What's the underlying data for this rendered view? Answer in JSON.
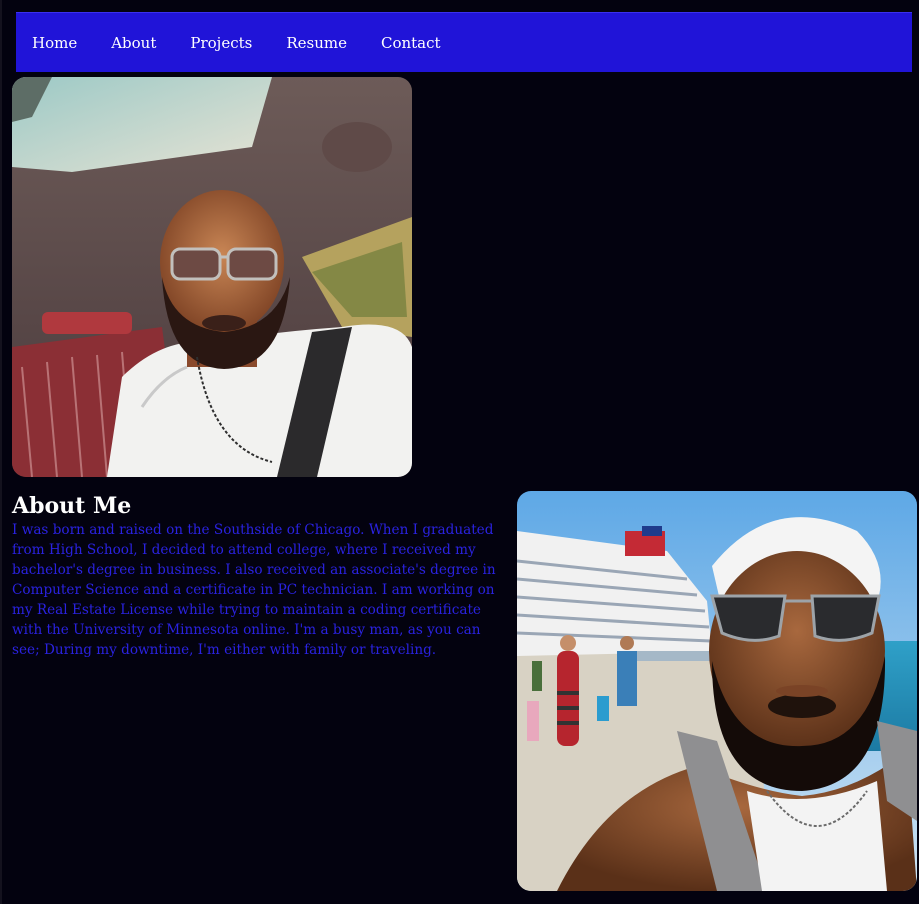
{
  "nav": {
    "items": [
      {
        "label": "Home"
      },
      {
        "label": "About"
      },
      {
        "label": "Projects"
      },
      {
        "label": "Resume"
      },
      {
        "label": "Contact"
      }
    ]
  },
  "images": {
    "car_photo": "man in sunglasses seated in car selfie",
    "cruise_photo": "man with beard and cap on cruise dock selfie"
  },
  "about": {
    "title": "About Me",
    "body": "I was born and raised on the Southside of Chicago. When I graduated from High School, I decided to attend college, where I received my bachelor's degree in business. I also received an associate's degree in Computer Science and a certificate in PC technician. I am working on my Real Estate License while trying to maintain a coding certificate with the University of Minnesota online. I'm a busy man, as you can see; During my downtime, I'm either with family or traveling."
  },
  "colors": {
    "nav_bg": "#2014d8",
    "page_bg": "#03020f",
    "body_text": "#2a22e0"
  }
}
